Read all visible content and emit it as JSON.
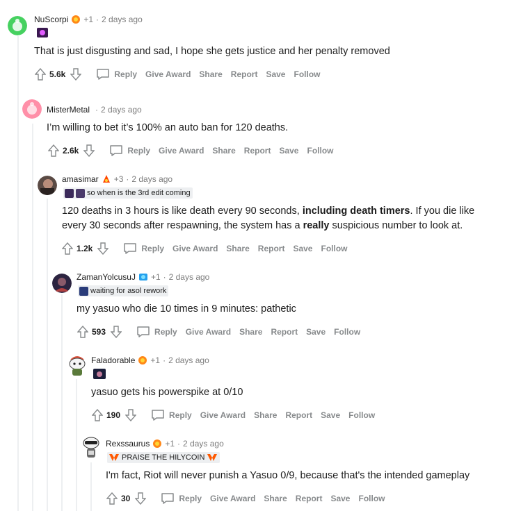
{
  "comments": [
    {
      "author": "NuScorpi",
      "karma": "+1",
      "time": "2 days ago",
      "flair": "",
      "text": "That is just disgusting and sad, I hope she gets justice and her penalty removed",
      "score": "5.6k"
    },
    {
      "author": "MisterMetal",
      "karma": "",
      "time": "2 days ago",
      "flair": "",
      "text": "I’m willing to bet it’s 100% an auto ban for 120 deaths.",
      "score": "2.6k"
    },
    {
      "author": "amasimar",
      "karma": "+3",
      "time": "2 days ago",
      "flair": "so when is the 3rd edit coming",
      "text_parts": {
        "a": "120 deaths in 3 hours is like death every 90 seconds, ",
        "b": "including death timers",
        "c": ". If you die like every 30 seconds after respawning, the system has a ",
        "d": "really",
        "e": " suspicious number to look at."
      },
      "score": "1.2k"
    },
    {
      "author": "ZamanYolcusuJ",
      "karma": "+1",
      "time": "2 days ago",
      "flair": "waiting for asol rework",
      "text": "my yasuo who die 10 times in 9 minutes: pathetic",
      "score": "593"
    },
    {
      "author": "Faladorable",
      "karma": "+1",
      "time": "2 days ago",
      "flair": "",
      "text": "yasuo gets his powerspike at 0/10",
      "score": "190"
    },
    {
      "author": "Rexssaurus",
      "karma": "+1",
      "time": "2 days ago",
      "flair": "PRAISE THE HILYCOIN",
      "text": "I'm fact, Riot will never punish a Yasuo 0/9, because that's the intended gameplay",
      "score": "30"
    }
  ],
  "actions": {
    "reply": "Reply",
    "give_award": "Give Award",
    "share": "Share",
    "report": "Report",
    "save": "Save",
    "follow": "Follow"
  },
  "separator": "·",
  "colors": {
    "background": "#ffffff",
    "thread_line": "#edeff1",
    "meta_text": "#7c7c7c",
    "action_text": "#878a8c",
    "flair_bg": "#edeff1",
    "fnatic_orange": "#ff5900"
  }
}
